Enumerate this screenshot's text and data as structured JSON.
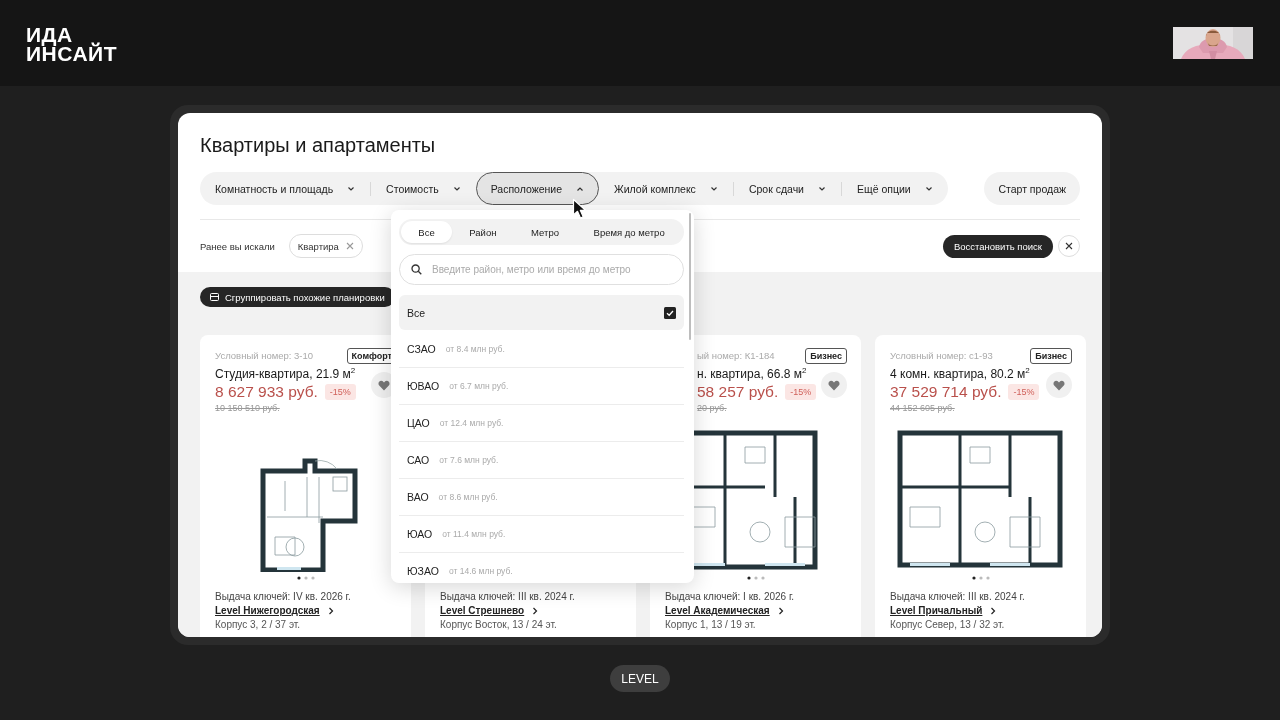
{
  "logo": [
    "ИДА",
    "ИНСАЙТ"
  ],
  "page": {
    "title": "Квартиры и апартаменты",
    "filters": [
      {
        "label": "Комнатность и площадь",
        "selected": false
      },
      {
        "label": "Стоимость",
        "selected": false
      },
      {
        "label": "Расположение",
        "selected": true
      },
      {
        "label": "Жилой комплекс",
        "selected": false
      },
      {
        "label": "Срок сдачи",
        "selected": false
      },
      {
        "label": "Ещё опции",
        "selected": false
      }
    ],
    "start_sales": "Старт продаж",
    "history_label": "Ранее вы искали",
    "history_chips": [
      "Квартира"
    ],
    "restore_button": "Восстановить поиск",
    "group_button": "Сгруппировать похожие планировки",
    "cards": [
      {
        "number": "Условный номер: 3-10",
        "tag": "Комфорт",
        "title": "Студия-квартира, 21.9 м$^{2}$",
        "price": "8 627 933 руб.",
        "discount": "-15%",
        "old_price": "10 150 510 руб.",
        "keys": "Выдача ключей: IV кв. 2026 г.",
        "complex": "Level Нижегородская",
        "building": "Корпус 3, 2 / 37 эт."
      },
      {
        "keys": "Выдача ключей: III кв. 2024 г.",
        "complex": "Level Стрешнево",
        "building": "Корпус Восток, 13 / 24 эт."
      },
      {
        "number": "ый номер: К1-184",
        "tag": "Бизнес",
        "title": "н. квартира, 66.8 м$^{2}$",
        "price": "58 257 руб.",
        "discount": "-15%",
        "old_price": "20 руб.",
        "keys": "Выдача ключей: I кв. 2026 г.",
        "complex": "Level Академическая",
        "building": "Корпус 1, 13 / 19 эт."
      },
      {
        "number": "Условный номер: с1-93",
        "tag": "Бизнес",
        "title": "4 комн. квартира, 80.2 м$^{2}$",
        "price": "37 529 714 руб.",
        "discount": "-15%",
        "old_price": "44 152 605 руб.",
        "keys": "Выдача ключей: III кв. 2024 г.",
        "complex": "Level Причальный",
        "building": "Корпус Север, 13 / 32 эт."
      }
    ]
  },
  "dropdown": {
    "tabs": [
      {
        "label": "Все",
        "selected": true
      },
      {
        "label": "Район",
        "selected": false
      },
      {
        "label": "Метро",
        "selected": false
      },
      {
        "label": "Время до метро",
        "selected": false
      }
    ],
    "search_placeholder": "Введите район, метро или время до метро",
    "options": [
      {
        "name": "Все",
        "checked": true
      },
      {
        "name": "СЗАО",
        "price": "от 8.4 млн руб.",
        "checked": false
      },
      {
        "name": "ЮВАО",
        "price": "от 6.7 млн руб.",
        "checked": false
      },
      {
        "name": "ЦАО",
        "price": "от 12.4 млн руб.",
        "checked": false
      },
      {
        "name": "САО",
        "price": "от 7.6 млн руб.",
        "checked": false
      },
      {
        "name": "ВАО",
        "price": "от 8.6 млн руб.",
        "checked": false
      },
      {
        "name": "ЮАО",
        "price": "от 11.4 млн руб.",
        "checked": false
      },
      {
        "name": "ЮЗАО",
        "price": "от 14.6 млн руб.",
        "checked": false
      }
    ]
  },
  "caption": "LEVEL"
}
